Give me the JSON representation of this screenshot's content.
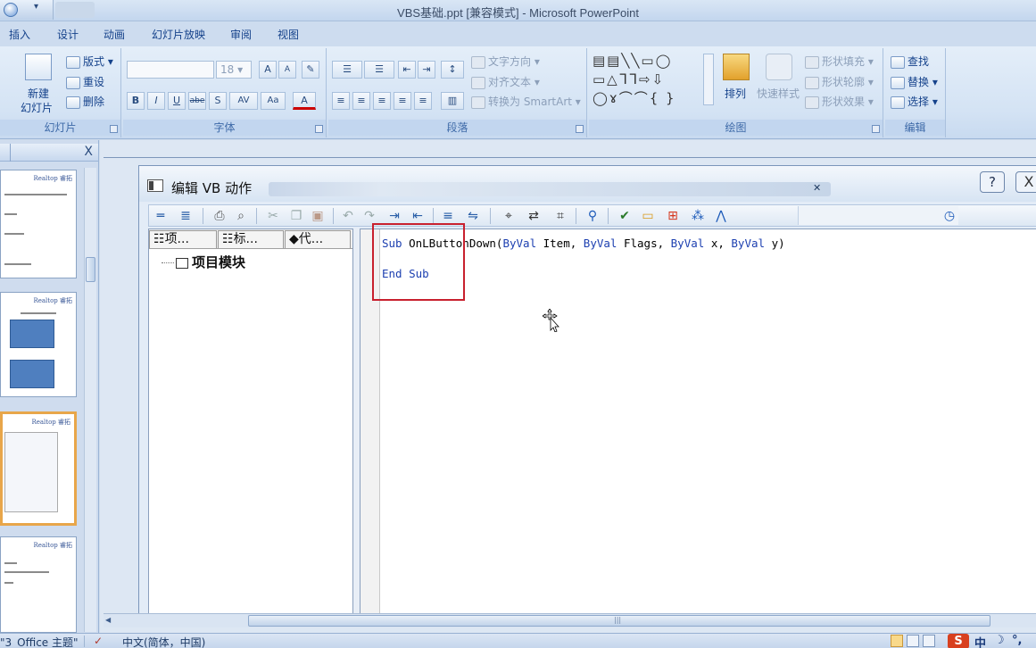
{
  "window": {
    "title": "VBS基础.ppt [兼容模式] - Microsoft PowerPoint",
    "qa_dropdown": "▾"
  },
  "ribbon_tabs": [
    "插入",
    "设计",
    "动画",
    "幻灯片放映",
    "审阅",
    "视图"
  ],
  "ribbon": {
    "slides": {
      "new_slide_top": "新建",
      "new_slide_bottom": "幻灯片",
      "layout": "版式",
      "reset": "重设",
      "delete": "删除",
      "group_label": "幻灯片"
    },
    "font": {
      "size": "18",
      "grow": "A",
      "shrink": "A",
      "bold": "B",
      "italic": "I",
      "underline": "U",
      "strike": "abe",
      "shadow": "S",
      "spacing": "AV",
      "case": "Aa",
      "color": "A",
      "group_label": "字体"
    },
    "paragraph": {
      "text_direction": "文字方向",
      "align_text": "对齐文本",
      "convert_smartart": "转换为 SmartArt",
      "group_label": "段落"
    },
    "drawing": {
      "arrange": "排列",
      "quick_styles": "快速样式",
      "shape_fill": "形状填充",
      "shape_outline": "形状轮廓",
      "shape_effects": "形状效果",
      "group_label": "绘图"
    },
    "editing": {
      "find": "查找",
      "replace": "替换",
      "select": "选择",
      "group_label": "编辑"
    }
  },
  "slide_pane": {
    "close": "X",
    "thumb_logo": "Realtop 睿拓"
  },
  "dialog": {
    "title": "编辑 VB 动作",
    "help": "?",
    "close": "X",
    "left_tabs": [
      "项...",
      "标...",
      "代..."
    ],
    "tree_root": "项目模块",
    "code": {
      "line1": {
        "sub": "Sub",
        "name": " OnLButtonDown(",
        "byval1": "ByVal",
        "item": " Item, ",
        "byval2": "ByVal",
        "flags": " Flags, ",
        "byval3": "ByVal",
        "x": " x, ",
        "byval4": "ByVal",
        "y": " y)"
      },
      "line2": {
        "end": "End",
        "sub": " Sub"
      }
    }
  },
  "status_bar": {
    "theme": "\"3_Office 主题\"",
    "language": "中文(简体，中国)",
    "ime_s": "S",
    "ime_zh": "中"
  },
  "colors": {
    "keyword": "#1c3fb0",
    "highlight_box": "#c8202e",
    "selected_thumb": "#e8a64a"
  }
}
